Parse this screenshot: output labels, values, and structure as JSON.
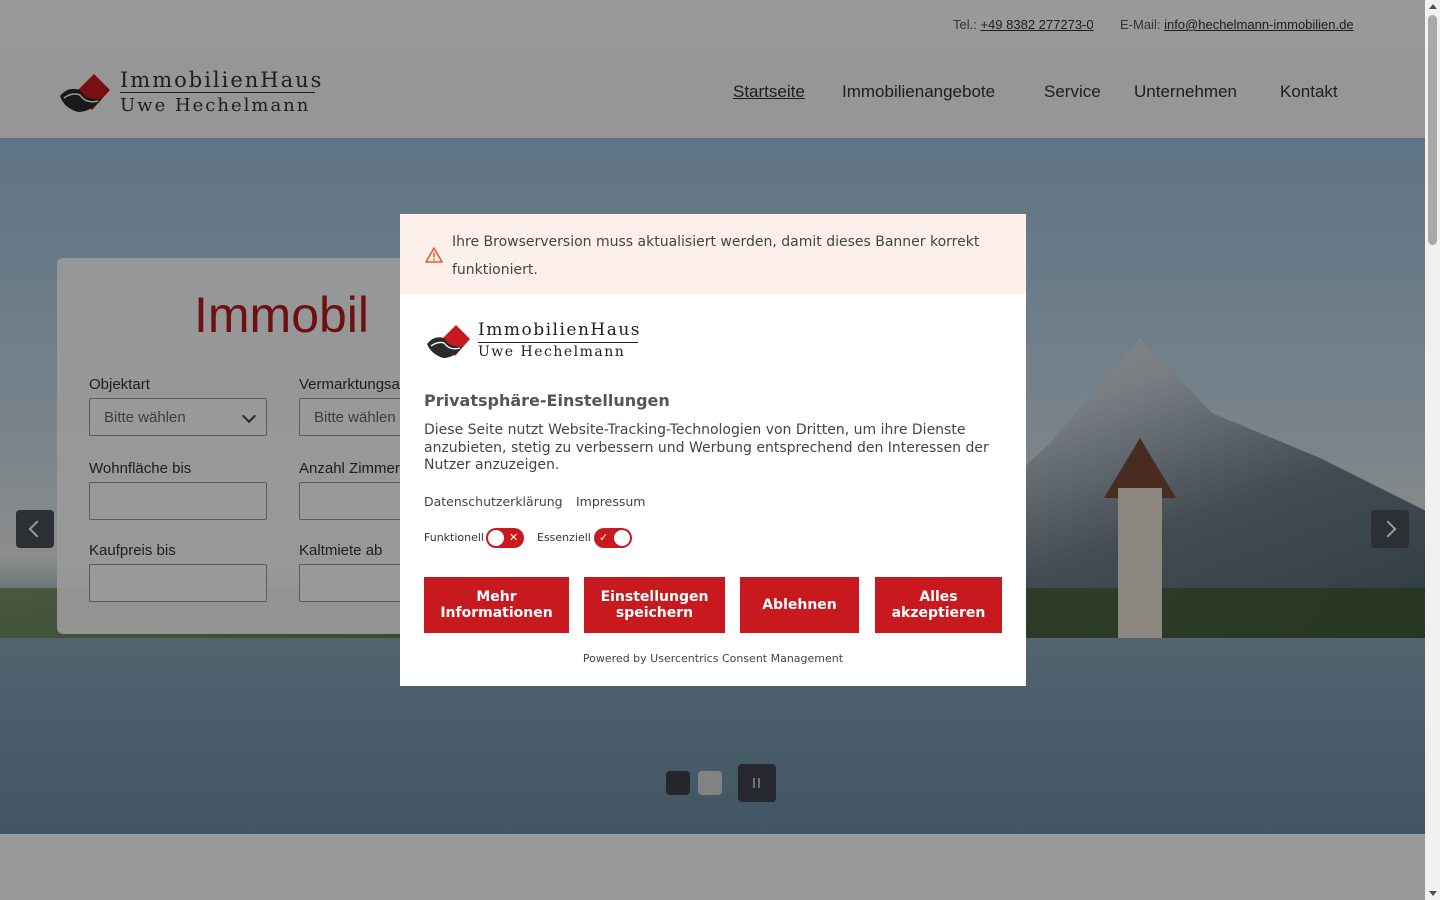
{
  "topbar": {
    "tel_label": "Tel.:",
    "tel_value": "+49 8382 277273-0",
    "mail_label": "E-Mail:",
    "mail_value": "info@hechelmann-immobilien.de"
  },
  "logo": {
    "line1": "ImmobilienHaus",
    "line2": "Uwe Hechelmann"
  },
  "nav": [
    "Startseite",
    "Immobilienangebote",
    "Service",
    "Unternehmen",
    "Kontakt"
  ],
  "search": {
    "title": "Immobil",
    "objektart_label": "Objektart",
    "objektart_value": "Bitte wählen",
    "vermarktung_label": "Vermarktungsa",
    "vermarktung_value": "Bitte wählen",
    "wohnflaeche_label": "Wohnfläche bis",
    "zimmer_label": "Anzahl Zimmer",
    "kaufpreis_label": "Kaufpreis bis",
    "kaltmiete_label": "Kaltmiete ab"
  },
  "consent": {
    "warning": "Ihre Browserversion muss aktualisiert werden, damit dieses Banner korrekt funktioniert.",
    "logo_line1": "ImmobilienHaus",
    "logo_line2": "Uwe Hechelmann",
    "title": "Privatsphäre-Einstellungen",
    "description": "Diese Seite nutzt Website-Tracking-Technologien von Dritten, um ihre Dienste anzubieten, stetig zu verbessern und Werbung entsprechend den Interessen der Nutzer anzuzeigen.",
    "link_privacy": "Datenschutzerklärung",
    "link_imprint": "Impressum",
    "toggle_functional_label": "Funktionell",
    "toggle_essential_label": "Essenziell",
    "btn_more": "Mehr Informationen",
    "btn_save": "Einstellungen speichern",
    "btn_deny": "Ablehnen",
    "btn_accept": "Alles akzeptieren",
    "powered_by": "Powered by Usercentrics Consent Management"
  },
  "colors": {
    "brand_red": "#c8191f",
    "warning_bg": "#fdf0ea"
  }
}
